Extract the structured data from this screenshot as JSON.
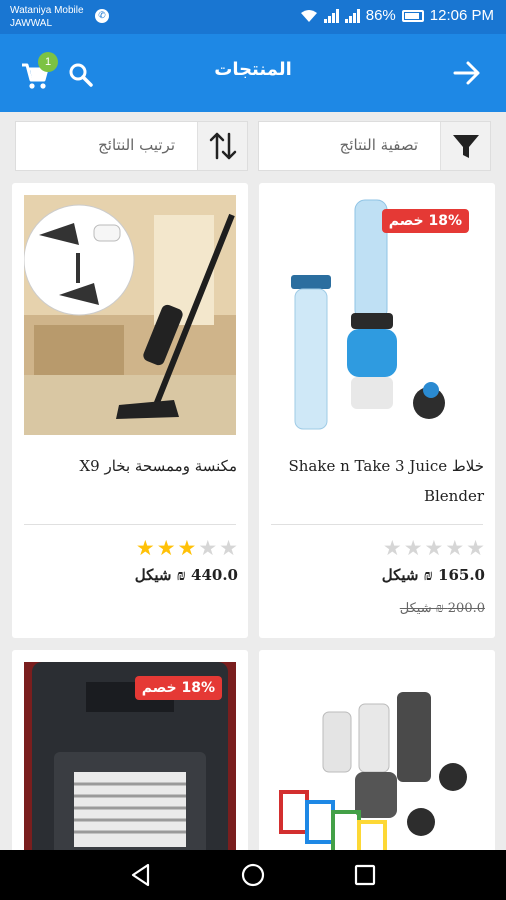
{
  "status_bar": {
    "carrier_line1": "Wataniya Mobile",
    "carrier_line2": "JAWWAL",
    "battery": "86%",
    "time": "12:06 PM"
  },
  "header": {
    "title": "المنتجات",
    "cart_count": "1",
    "icons": {
      "back": "arrow-forward-icon",
      "search": "search-icon",
      "cart": "cart-icon"
    },
    "color": "#1e88e5"
  },
  "controls": {
    "filter_label": "تصفية النتائج",
    "sort_label": "ترتيب النتائج"
  },
  "products": [
    {
      "name": "خلاط Shake n Take 3 Juice Blender",
      "price": "165.0 ₪ شيكل",
      "old_price": "200.0 ₪ شيكل",
      "discount": "18% خصم",
      "rating": 0
    },
    {
      "name": "مكنسة وممسحة بخار X9",
      "price": "440.0 ₪ شيكل",
      "rating": 3
    },
    {
      "name": "",
      "discount": ""
    },
    {
      "name": "",
      "discount": "18% خصم"
    }
  ],
  "colors": {
    "discount_badge": "#e53935",
    "star_on": "#ffc107",
    "star_off": "#d6d6d6",
    "cart_badge": "#7cc243"
  }
}
